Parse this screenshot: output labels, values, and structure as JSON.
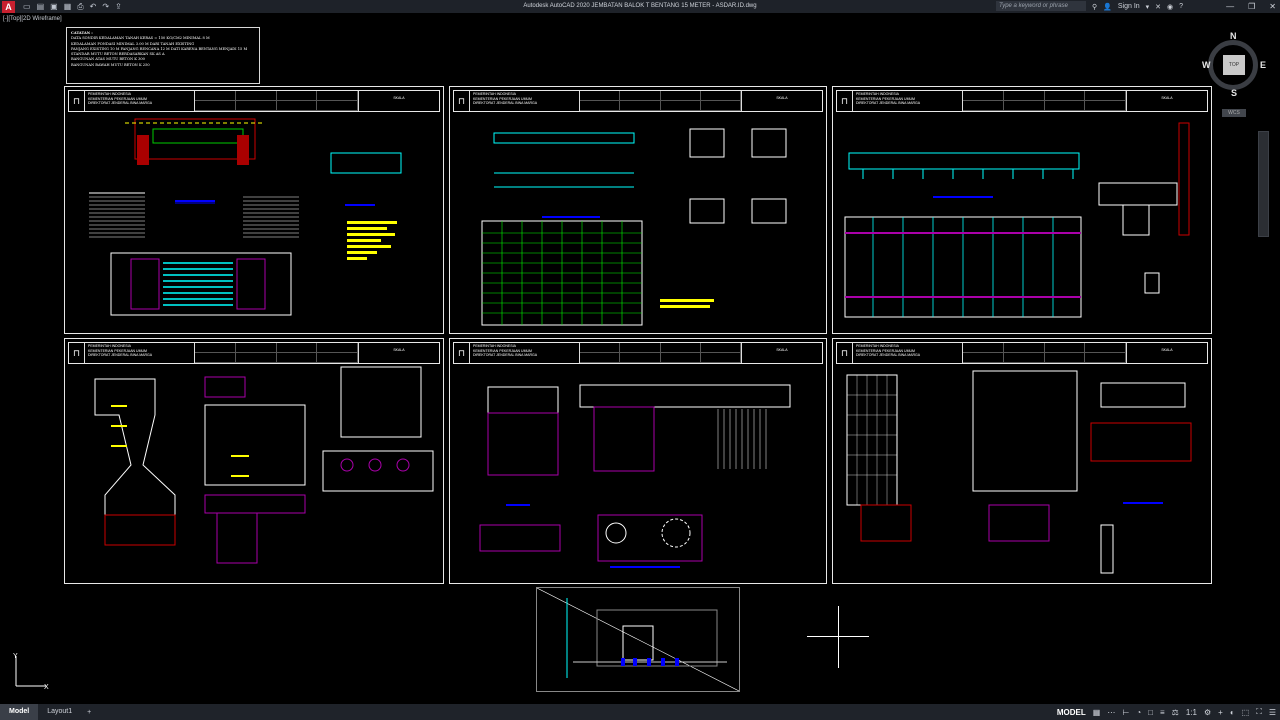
{
  "titlebar": {
    "app_logo": "A",
    "title": "Autodesk AutoCAD 2020   JEMBATAN BALOK T BENTANG 15 METER - ASDAR.ID.dwg",
    "search_placeholder": "Type a keyword or phrase",
    "sign_in": "Sign In",
    "quick_access_icons": [
      "new-icon",
      "open-icon",
      "save-icon",
      "saveas-icon",
      "plot-icon",
      "undo-icon",
      "redo-icon",
      "share-icon"
    ]
  },
  "viewport": {
    "label": "[-][Top][2D Wireframe]"
  },
  "notes": {
    "title": "CATATAN :",
    "lines": [
      "DATA SONDIR KEDALAMAN TANAH KERAS = 150 KG/CM2 MINIMAL 8 M",
      "KEDALAMAN PONDASI MINIMAL 3.00 M DARI TANAH EXISTING",
      "PANJANG EXISTING 10 M PANJANG RENCANA 12 M DATI KARENA BENTANG MENJADI 15 M",
      "STANDAR MUTU BETON BERDASARKAN SK AS A",
      "BANGUNAN ATAS MUTU BETON K 300",
      "BANGUNAN BAWAH MUTU BETON K 250"
    ]
  },
  "sheet_header": {
    "org": [
      "PEMERINTAH INDONESIA",
      "KEMENTERIAN PEKERJAAN UMUM",
      "DIREKTORAT JENDERAL BINA MARGA"
    ],
    "scale_label": "SKALA",
    "sheets": [
      "1",
      "2",
      "3",
      "4",
      "5",
      "6"
    ]
  },
  "viewcube": {
    "top": "TOP",
    "n": "N",
    "s": "S",
    "e": "E",
    "w": "W",
    "wcs": "WCS"
  },
  "ucs": {
    "x": "X",
    "y": "Y"
  },
  "statusbar": {
    "tabs": [
      "Model",
      "Layout1"
    ],
    "add_tab": "+",
    "model_label": "MODEL",
    "scale": "1:1"
  }
}
